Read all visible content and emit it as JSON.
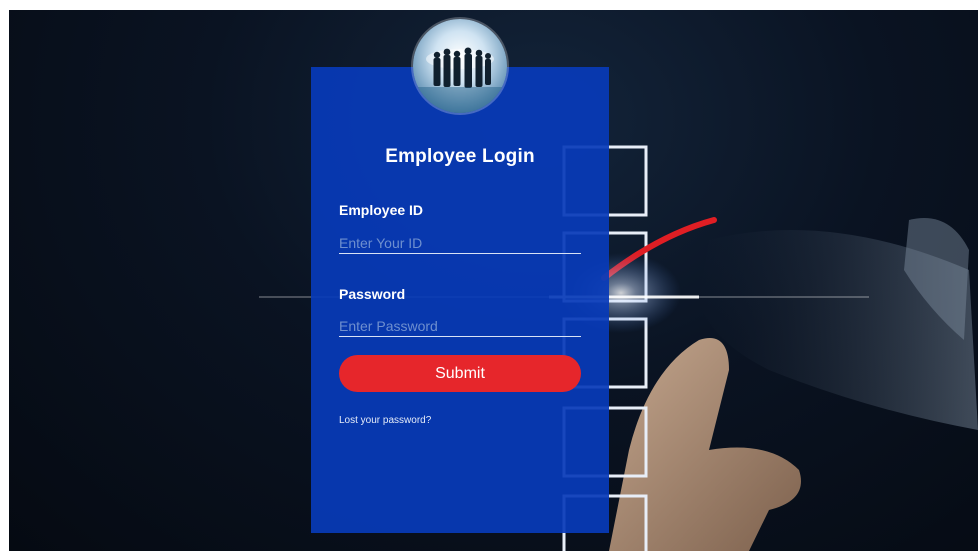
{
  "login": {
    "title": "Employee Login",
    "employee_id": {
      "label": "Employee ID",
      "placeholder": "Enter Your ID",
      "value": ""
    },
    "password": {
      "label": "Password",
      "placeholder": "Enter Password",
      "value": ""
    },
    "submit_label": "Submit",
    "lost_password_link": "Lost your password?"
  },
  "colors": {
    "card_background": "#083ab8",
    "submit_button": "#e6262b",
    "text": "#ffffff",
    "backdrop": "#0a1322"
  },
  "icons": {
    "avatar": "business-people-icon"
  }
}
